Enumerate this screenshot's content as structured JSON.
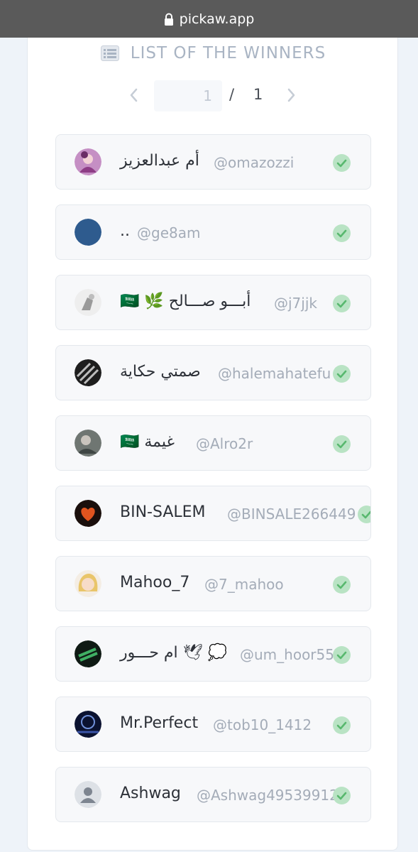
{
  "browser": {
    "url": "pickaw.app"
  },
  "header": {
    "title": "LIST OF THE WINNERS",
    "icon": "list-icon"
  },
  "pagination": {
    "current_page": "1",
    "separator": "/",
    "total_pages": "1"
  },
  "colors": {
    "check": "#58b86e",
    "check_bg": "#b9e3c4",
    "heading": "#a9b4c3"
  },
  "winners": [
    {
      "name": "أم عبدالعزيز",
      "handle": "@omazozzi",
      "avatar": "avatar-illustration-purple"
    },
    {
      "name": "..",
      "handle": "@ge8am",
      "avatar": "avatar-solid-blue"
    },
    {
      "name": "🇸🇦 🌿 أبـــو صـــالح",
      "handle": "@j7jjk",
      "avatar": "avatar-photo-light"
    },
    {
      "name": "صمتي حكاية",
      "handle": "@halemahatefu",
      "avatar": "avatar-pattern-dark"
    },
    {
      "name": "🇸🇦 غيمة",
      "handle": "@Alro2r",
      "avatar": "avatar-photo-gray"
    },
    {
      "name": "BIN-SALEM",
      "handle": "@BINSALE266449",
      "avatar": "avatar-heart"
    },
    {
      "name": "Mahoo_7",
      "handle": "@7_mahoo",
      "avatar": "avatar-cartoon-girl"
    },
    {
      "name": "ام حـــور 🕊 💭",
      "handle": "@um_hoor55",
      "avatar": "avatar-green-dark"
    },
    {
      "name": "Mr.Perfect",
      "handle": "@tob10_1412",
      "avatar": "avatar-night-blue"
    },
    {
      "name": "Ashwag",
      "handle": "@Ashwag49539912",
      "avatar": "avatar-default-person"
    }
  ]
}
